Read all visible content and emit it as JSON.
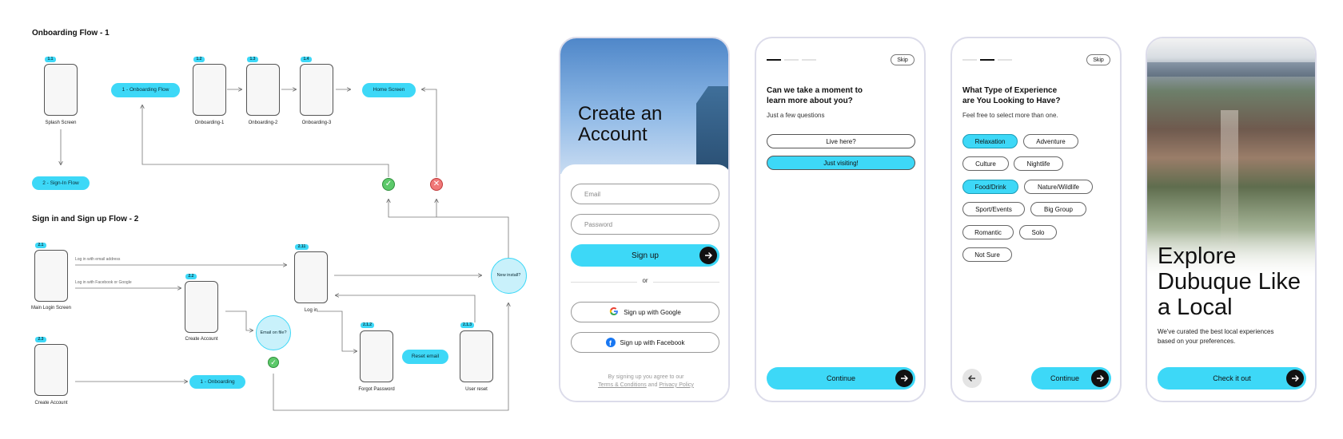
{
  "flow1": {
    "title": "Onboarding Flow - 1",
    "splash_badge": "1.1",
    "splash_caption": "Splash Screen",
    "onboarding_flow_pill": "1 - Onboarding Flow",
    "ob1_badge": "1.2",
    "ob1_caption": "Onboarding-1",
    "ob2_badge": "1.3",
    "ob2_caption": "Onboarding-2",
    "ob3_badge": "1.4",
    "ob3_caption": "Onboarding-3",
    "home_pill": "Home Screen",
    "signin_pill": "2 - Sign-In Flow"
  },
  "flow2": {
    "title": "Sign in and Sign up Flow - 2",
    "main_badge": "2.1",
    "main_caption": "Main Login Screen",
    "email_note": "Log in with email address",
    "fb_note": "Log in with Facebook or Google",
    "create_badge": "2.2",
    "create_caption": "Create Account",
    "login_badge": "2.11",
    "login_caption": "Log in",
    "email_on_file": "Email on file?",
    "forgot_badge": "2.1.2",
    "forgot_caption": "Forgot Password",
    "reset_pill": "Reset email",
    "userreset_badge": "2.1.3",
    "userreset_caption": "User reset",
    "new_install": "New install?",
    "create2_badge": "2.3",
    "create2_caption": "Create Account",
    "onboarding_pill": "1 - Onboarding"
  },
  "signup": {
    "headline": "Create an Account",
    "email_placeholder": "Email",
    "password_placeholder": "Password",
    "signup_label": "Sign up",
    "or_label": "or",
    "google_label": "Sign up with Google",
    "facebook_label": "Sign up with Facebook",
    "terms_line": "By signing up you agree to our",
    "terms_link": "Terms & Conditions",
    "and_word": "and",
    "privacy_link": "Privacy Policy"
  },
  "about": {
    "skip_label": "Skip",
    "question": "Can we take a moment to learn more about you?",
    "subtitle": "Just a few questions",
    "option1": "Live here?",
    "option2": "Just visiting!",
    "continue_label": "Continue"
  },
  "experience": {
    "skip_label": "Skip",
    "question": "What Type of Experience are You Looking to Have?",
    "subtitle": "Feel free to select more than one.",
    "chips": [
      "Relaxation",
      "Adventure",
      "Culture",
      "Nightlife",
      "Food/Drink",
      "Nature/Wildlife",
      "Sport/Events",
      "Big Group",
      "Romantic",
      "Solo",
      "Not Sure"
    ],
    "continue_label": "Continue"
  },
  "explore": {
    "headline": "Explore Dubuque Like a Local",
    "body": "We've curated the best local experiences based on your preferences.",
    "cta_label": "Check it out"
  },
  "colors": {
    "accent": "#3dd8f7",
    "success": "#5cc96a",
    "error": "#f07878"
  }
}
